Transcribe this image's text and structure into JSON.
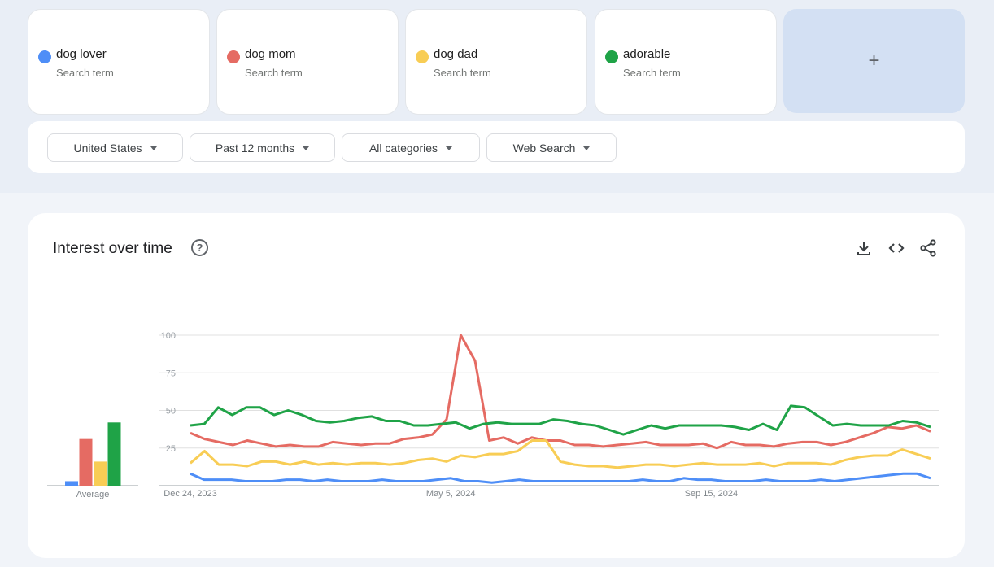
{
  "search_terms": [
    {
      "name": "dog lover",
      "subtitle": "Search term",
      "color": "#4e8ef7"
    },
    {
      "name": "dog mom",
      "subtitle": "Search term",
      "color": "#e56b63"
    },
    {
      "name": "dog dad",
      "subtitle": "Search term",
      "color": "#f8cd55"
    },
    {
      "name": "adorable",
      "subtitle": "Search term",
      "color": "#1fa347"
    }
  ],
  "add_term": {
    "icon": "plus-icon",
    "label": "+"
  },
  "filters": [
    {
      "label": "United States",
      "icon": "caret-down-icon"
    },
    {
      "label": "Past 12 months",
      "icon": "caret-down-icon"
    },
    {
      "label": "All categories",
      "icon": "caret-down-icon"
    },
    {
      "label": "Web Search",
      "icon": "caret-down-icon"
    }
  ],
  "panel": {
    "title": "Interest over time",
    "help_icon": "?",
    "actions": [
      "download-icon",
      "embed-code-icon",
      "share-icon"
    ]
  },
  "chart_data": [
    {
      "type": "bar",
      "title": "",
      "categories": [
        "dog lover",
        "dog mom",
        "dog dad",
        "adorable"
      ],
      "values": [
        3,
        31,
        16,
        42
      ],
      "colors": [
        "#4e8ef7",
        "#e56b63",
        "#f8cd55",
        "#1fa347"
      ],
      "xlabel": "Average",
      "ylim": [
        0,
        100
      ]
    },
    {
      "type": "line",
      "title": "Interest over time",
      "x_tick_labels": [
        {
          "label": "Dec 24, 2023",
          "index": 0
        },
        {
          "label": "May 5, 2024",
          "index": 19
        },
        {
          "label": "Sep 15, 2024",
          "index": 38
        }
      ],
      "y_ticks": [
        25,
        50,
        75,
        100
      ],
      "ylim": [
        0,
        100
      ],
      "grid": true,
      "points": 53,
      "series": [
        {
          "name": "dog lover",
          "color": "#4e8ef7",
          "values": [
            8,
            4,
            4,
            4,
            3,
            3,
            3,
            4,
            4,
            3,
            4,
            3,
            3,
            3,
            4,
            3,
            3,
            3,
            4,
            5,
            3,
            3,
            2,
            3,
            4,
            3,
            3,
            3,
            3,
            3,
            3,
            3,
            3,
            4,
            3,
            3,
            5,
            4,
            4,
            3,
            3,
            3,
            4,
            3,
            3,
            3,
            4,
            3,
            4,
            5,
            6,
            7,
            8,
            8,
            5
          ]
        },
        {
          "name": "dog mom",
          "color": "#e56b63",
          "values": [
            35,
            31,
            29,
            27,
            30,
            28,
            26,
            27,
            26,
            26,
            29,
            28,
            27,
            28,
            28,
            31,
            32,
            34,
            44,
            100,
            83,
            30,
            32,
            28,
            32,
            30,
            30,
            27,
            27,
            26,
            27,
            28,
            29,
            27,
            27,
            27,
            28,
            25,
            29,
            27,
            27,
            26,
            28,
            29,
            29,
            27,
            29,
            32,
            35,
            39,
            38,
            40,
            36
          ]
        },
        {
          "name": "dog dad",
          "color": "#f8cd55",
          "values": [
            15,
            23,
            14,
            14,
            13,
            16,
            16,
            14,
            16,
            14,
            15,
            14,
            15,
            15,
            14,
            15,
            17,
            18,
            16,
            20,
            19,
            21,
            21,
            23,
            30,
            30,
            16,
            14,
            13,
            13,
            12,
            13,
            14,
            14,
            13,
            14,
            15,
            14,
            14,
            14,
            15,
            13,
            15,
            15,
            15,
            14,
            17,
            19,
            20,
            20,
            24,
            21,
            18
          ]
        },
        {
          "name": "adorable",
          "color": "#1fa347",
          "values": [
            40,
            41,
            52,
            47,
            52,
            52,
            47,
            50,
            47,
            43,
            42,
            43,
            45,
            46,
            43,
            43,
            40,
            40,
            41,
            42,
            38,
            41,
            42,
            41,
            41,
            41,
            44,
            43,
            41,
            40,
            37,
            34,
            37,
            40,
            38,
            40,
            40,
            40,
            40,
            39,
            37,
            41,
            37,
            53,
            52,
            46,
            40,
            41,
            40,
            40,
            40,
            43,
            42,
            39
          ]
        }
      ]
    }
  ]
}
